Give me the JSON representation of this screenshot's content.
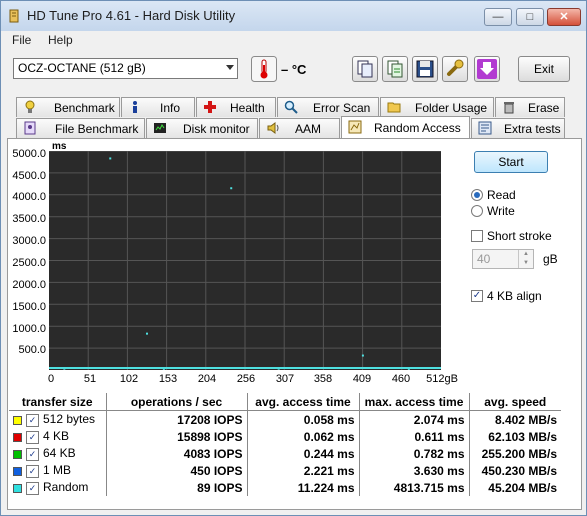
{
  "window": {
    "title": "HD Tune Pro 4.61 - Hard Disk Utility",
    "buttons": {
      "minimize": "—",
      "maximize": "□",
      "close": "✕"
    }
  },
  "menu": {
    "file": "File",
    "help": "Help"
  },
  "toolbar": {
    "drive": "OCZ-OCTANE (512 gB)",
    "temperature": "– °C",
    "exit_label": "Exit"
  },
  "tabs_row1": [
    {
      "label": "Benchmark",
      "icon": "benchmark-icon"
    },
    {
      "label": "Info",
      "icon": "info-icon"
    },
    {
      "label": "Health",
      "icon": "health-icon"
    },
    {
      "label": "Error Scan",
      "icon": "error-scan-icon"
    },
    {
      "label": "Folder Usage",
      "icon": "folder-usage-icon"
    },
    {
      "label": "Erase",
      "icon": "erase-icon"
    }
  ],
  "tabs_row2": [
    {
      "label": "File Benchmark",
      "icon": "file-benchmark-icon"
    },
    {
      "label": "Disk monitor",
      "icon": "disk-monitor-icon"
    },
    {
      "label": "AAM",
      "icon": "aam-icon"
    },
    {
      "label": "Random Access",
      "icon": "random-access-icon",
      "active": true
    },
    {
      "label": "Extra tests",
      "icon": "extra-tests-icon"
    }
  ],
  "chart_data": {
    "type": "scatter",
    "ylabel": "ms",
    "ylim": [
      0,
      5000
    ],
    "yticks": [
      "5000.0",
      "4500.0",
      "4000.0",
      "3500.0",
      "3000.0",
      "2500.0",
      "2000.0",
      "1500.0",
      "1000.0",
      "500.0"
    ],
    "xlim": [
      0,
      512
    ],
    "xticks": [
      "0",
      "51",
      "102",
      "153",
      "204",
      "256",
      "307",
      "358",
      "409",
      "460",
      "512gB"
    ],
    "grid": true,
    "series": [
      {
        "color": "#4ee0e0",
        "points": [
          [
            80,
            4830
          ],
          [
            238,
            4150
          ],
          [
            128,
            830
          ],
          [
            410,
            330
          ],
          [
            20,
            30
          ],
          [
            150,
            25
          ],
          [
            300,
            30
          ],
          [
            470,
            25
          ]
        ]
      }
    ]
  },
  "controls": {
    "start_label": "Start",
    "read_label": "Read",
    "write_label": "Write",
    "short_stroke_label": "Short stroke",
    "stroke_value": "40",
    "stroke_unit": "gB",
    "align_label": "4 KB align"
  },
  "results": {
    "headers": [
      "transfer size",
      "operations / sec",
      "avg. access time",
      "max. access time",
      "avg. speed"
    ],
    "rows": [
      {
        "color": "#ffff00",
        "size": "512 bytes",
        "ops": "17208 IOPS",
        "avg": "0.058 ms",
        "max": "2.074 ms",
        "speed": "8.402 MB/s"
      },
      {
        "color": "#e00000",
        "size": "4 KB",
        "ops": "15898 IOPS",
        "avg": "0.062 ms",
        "max": "0.611 ms",
        "speed": "62.103 MB/s"
      },
      {
        "color": "#00c000",
        "size": "64 KB",
        "ops": "4083 IOPS",
        "avg": "0.244 ms",
        "max": "0.782 ms",
        "speed": "255.200 MB/s"
      },
      {
        "color": "#1060e0",
        "size": "1 MB",
        "ops": "450 IOPS",
        "avg": "2.221 ms",
        "max": "3.630 ms",
        "speed": "450.230 MB/s"
      },
      {
        "color": "#30e0e0",
        "size": "Random",
        "ops": "89 IOPS",
        "avg": "11.224 ms",
        "max": "4813.715 ms",
        "speed": "45.204 MB/s"
      }
    ]
  }
}
